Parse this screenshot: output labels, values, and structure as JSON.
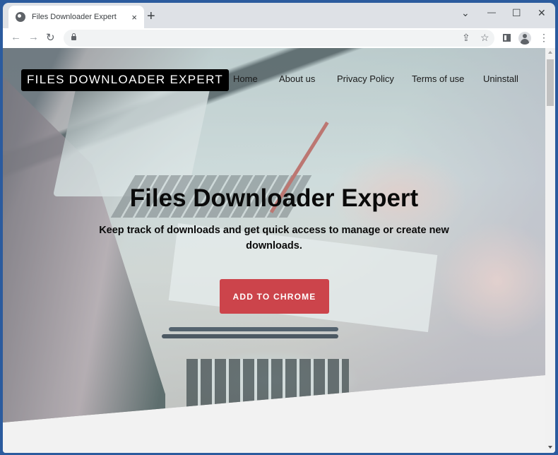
{
  "browser": {
    "tab_title": "Files Downloader Expert",
    "tab_close_icon": "×",
    "new_tab_icon": "+",
    "window_controls": {
      "tab_search": "⌄",
      "minimize": "—",
      "maximize": "☐",
      "close": "✕"
    },
    "nav": {
      "back": "←",
      "forward": "→",
      "reload": "↻"
    },
    "address_url": "",
    "toolbar_icons": {
      "share": "⇪",
      "bookmark": "☆",
      "menu": "⋮"
    }
  },
  "site": {
    "logo": "FILES DOWNLOADER EXPERT",
    "nav_items": [
      {
        "label": "Home"
      },
      {
        "label": "About us"
      },
      {
        "label": "Privacy Policy"
      },
      {
        "label": "Terms of use"
      },
      {
        "label": "Uninstall"
      }
    ],
    "hero": {
      "title": "Files Downloader Expert",
      "subtitle": "Keep track of downloads and get quick access to manage or create new downloads.",
      "cta_label": "ADD TO CHROME"
    }
  },
  "colors": {
    "cta": "#cc444b",
    "logo_bg": "#000000",
    "page_bg": "#f2f2f2",
    "frame": "#2b5b9e"
  }
}
